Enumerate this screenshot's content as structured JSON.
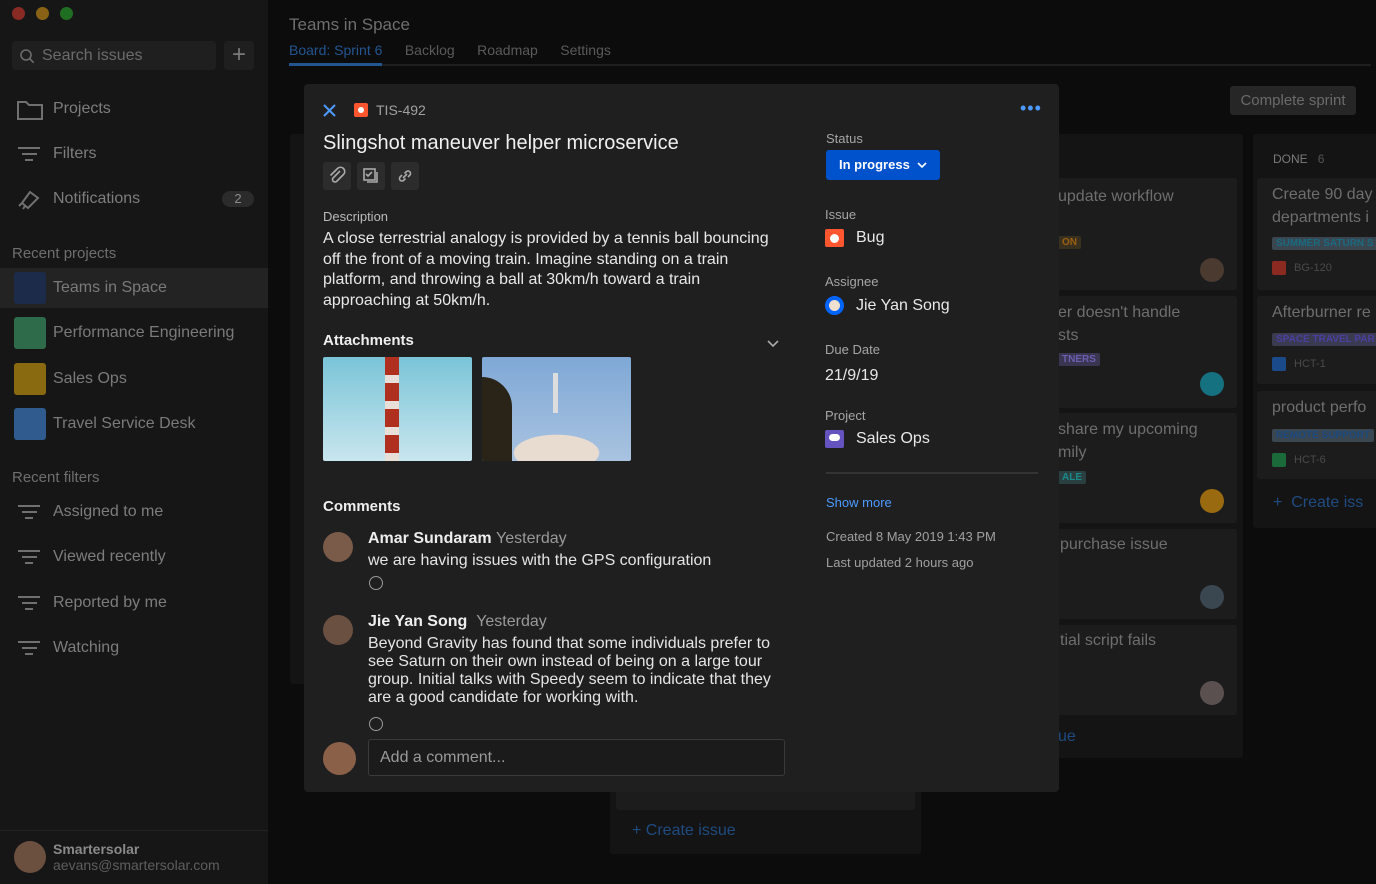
{
  "window": {
    "controls": [
      "close",
      "minimize",
      "maximize"
    ]
  },
  "sidebar": {
    "search_placeholder": "Search issues",
    "nav": [
      {
        "label": "Projects",
        "icon": "folder-icon"
      },
      {
        "label": "Filters",
        "icon": "filter-icon"
      },
      {
        "label": "Notifications",
        "icon": "bell-icon",
        "badge": "2"
      }
    ],
    "recent_projects_title": "Recent projects",
    "projects": [
      {
        "label": "Teams in Space",
        "color": "#1d2b4a"
      },
      {
        "label": "Performance Engineering",
        "color": "#2e6b4a"
      },
      {
        "label": "Sales Ops",
        "color": "#8a6a10"
      },
      {
        "label": "Travel Service Desk",
        "color": "#2f5b8f"
      }
    ],
    "recent_filters_title": "Recent filters",
    "filters": [
      {
        "label": "Assigned to me"
      },
      {
        "label": "Viewed recently"
      },
      {
        "label": "Reported by me"
      },
      {
        "label": "Watching"
      }
    ],
    "user": {
      "name": "Smartersolar",
      "email": "aevans@smartersolar.com"
    }
  },
  "header": {
    "title": "Teams in Space",
    "tabs": [
      "Board: Sprint 6",
      "Backlog",
      "Roadmap",
      "Settings"
    ],
    "active_tab": 0,
    "complete_sprint": "Complete sprint"
  },
  "board": {
    "col3_cards": [
      {
        "title": [
          "update workflow",
          ""
        ],
        "lozenge": "ON",
        "lozenge_color": "#c77a10"
      },
      {
        "title": [
          "er doesn't handle",
          "sts"
        ],
        "lozenge": "TNERS",
        "lozenge_color": "#5d4fa0"
      },
      {
        "title": [
          "share my upcoming",
          "mily"
        ],
        "lozenge": "ALE",
        "lozenge_color": "#1b8a8a"
      },
      {
        "title": [
          "purchase issue",
          ""
        ]
      },
      {
        "title": [
          "tial script fails",
          ""
        ]
      }
    ],
    "col3_create": "ue",
    "done": {
      "title": "DONE",
      "count": "6",
      "cards": [
        {
          "title": [
            "Create 90 day",
            "departments i"
          ],
          "lozenge": "SUMMER SATURN S",
          "key": "BG-120",
          "type_color": "#c0392b"
        },
        {
          "title": [
            "Afterburner re",
            ""
          ],
          "lozenge": "SPACE TRAVEL PAR",
          "key": "HCT-1",
          "type_color": "#1d5fc2"
        },
        {
          "title": [
            "product perfo",
            ""
          ],
          "lozenge": "REMOTE SUPPORT",
          "key": "HCT-6",
          "type_color": "#1f8a4a"
        }
      ],
      "create": "Create iss"
    },
    "col2_create": "Create issue"
  },
  "issue": {
    "key": "TIS-492",
    "type_color": "#ff5630",
    "title": "Slingshot maneuver helper microservice",
    "toolbar": [
      "paperclip-icon",
      "subtask-icon",
      "link-icon"
    ],
    "description_label": "Description",
    "description": "A close terrestrial analogy is provided by a tennis ball bouncing off the front of a moving train. Imagine standing on a train platform, and throwing a ball at 30km/h toward a train approaching at 50km/h.",
    "attachments_label": "Attachments",
    "comments_label": "Comments",
    "comments": [
      {
        "author": "Amar Sundaram",
        "time": "Yesterday",
        "body": "we are having issues with the GPS configuration"
      },
      {
        "author": "Jie Yan Song",
        "time": "Yesterday",
        "body": "Beyond Gravity has found that some individuals prefer to see Saturn on their own instead of being on a large tour group. Initial talks with Speedy seem to indicate that they are a good candidate for working with."
      }
    ],
    "comment_placeholder": "Add a comment...",
    "status_label": "Status",
    "status": "In progress",
    "status_color": "#0052cc",
    "issue_label": "Issue",
    "issue_type": "Bug",
    "assignee_label": "Assignee",
    "assignee": "Jie Yan Song",
    "due_label": "Due Date",
    "due": "21/9/19",
    "project_label": "Project",
    "project": "Sales Ops",
    "show_more": "Show more",
    "created": "Created 8 May 2019 1:43 PM",
    "updated": "Last updated 2 hours ago"
  }
}
